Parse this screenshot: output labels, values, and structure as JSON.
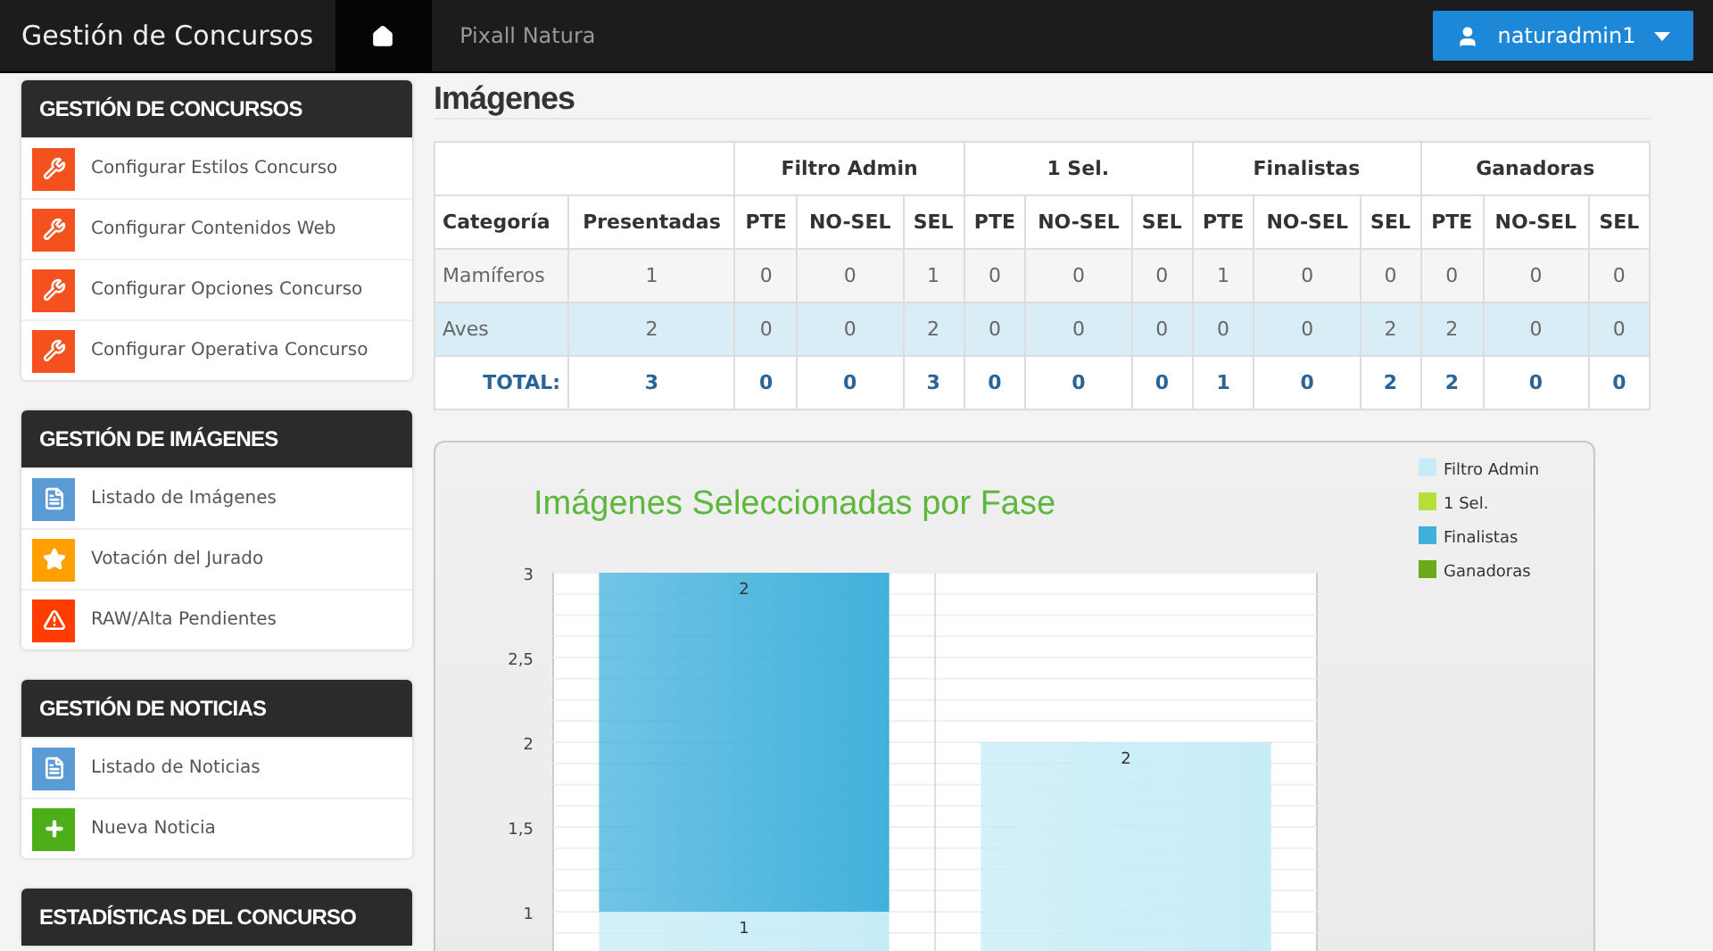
{
  "navbar": {
    "brand": "Gestión de Concursos",
    "tabs": [
      {
        "kind": "home",
        "selected": true
      },
      {
        "kind": "text",
        "label": "Pixall Natura",
        "selected": false
      }
    ],
    "user_button": {
      "label": "naturadmin1"
    }
  },
  "sidebar": {
    "sections": [
      {
        "title": "GESTIÓN DE CONCURSOS",
        "items": [
          {
            "kind": "wrench",
            "color": "#f4511e",
            "label": "Configurar Estilos Concurso"
          },
          {
            "kind": "wrench",
            "color": "#f4511e",
            "label": "Configurar Contenidos Web"
          },
          {
            "kind": "wrench",
            "color": "#f4511e",
            "label": "Configurar Opciones Concurso"
          },
          {
            "kind": "wrench",
            "color": "#f4511e",
            "label": "Configurar Operativa Concurso"
          }
        ]
      },
      {
        "title": "GESTIÓN DE IMÁGENES",
        "items": [
          {
            "kind": "document",
            "color": "#5b9bd5",
            "label": "Listado de Imágenes"
          },
          {
            "kind": "star",
            "color": "#ffa000",
            "label": "Votación del Jurado"
          },
          {
            "kind": "warning",
            "color": "#ff3d00",
            "label": "RAW/Alta Pendientes"
          }
        ]
      },
      {
        "title": "GESTIÓN DE NOTICIAS",
        "items": [
          {
            "kind": "document",
            "color": "#5b9bd5",
            "label": "Listado de Noticias"
          },
          {
            "kind": "plus",
            "color": "#4caf1a",
            "label": "Nueva Noticia"
          }
        ]
      },
      {
        "title": "ESTADÍSTICAS DEL CONCURSO"
      }
    ]
  },
  "main": {
    "title": "Imágenes",
    "table": {
      "group_headers": [
        "Filtro Admin",
        "1 Sel.",
        "Finalistas",
        "Ganadoras"
      ],
      "columns": [
        "Categoría",
        "Presentadas",
        "PTE",
        "NO-SEL",
        "SEL",
        "PTE",
        "NO-SEL",
        "SEL",
        "PTE",
        "NO-SEL",
        "SEL",
        "PTE",
        "NO-SEL",
        "SEL"
      ],
      "rows": [
        {
          "kind": "data",
          "highlighted": false,
          "cells": [
            "Mamíferos",
            "1",
            "0",
            "0",
            "1",
            "0",
            "0",
            "0",
            "1",
            "0",
            "0",
            "0",
            "0",
            "0"
          ]
        },
        {
          "kind": "data",
          "highlighted": true,
          "cells": [
            "Aves",
            "2",
            "0",
            "0",
            "2",
            "0",
            "0",
            "0",
            "0",
            "0",
            "2",
            "2",
            "0",
            "0"
          ]
        },
        {
          "kind": "total",
          "highlighted": false,
          "cells": [
            "TOTAL:",
            "3",
            "0",
            "0",
            "3",
            "0",
            "0",
            "0",
            "1",
            "0",
            "2",
            "2",
            "0",
            "0"
          ]
        }
      ]
    },
    "chart": {
      "chart_data": {
        "type": "bar",
        "stacked": true,
        "title": "Imágenes Seleccionadas por Fase",
        "data_labels": true,
        "grid": true,
        "legend": true,
        "ylim": [
          0,
          3
        ],
        "value_labels": [
          [
            "1",
            "2"
          ],
          [
            null,
            null
          ],
          [
            "2",
            null
          ],
          [
            null,
            null
          ]
        ],
        "yticks": [
          1,
          {
            "value": 1.5,
            "label": "1,5"
          },
          2,
          {
            "value": 2.5,
            "label": "2,5"
          },
          3
        ],
        "series": [
          {
            "name": "Filtro Admin",
            "color": "#c6ecf8",
            "values": [
              1,
              2
            ]
          },
          {
            "name": "1 Sel.",
            "color": "#b5e03a",
            "values": [
              0,
              0
            ]
          },
          {
            "name": "Finalistas",
            "color": "#41b1dc",
            "values": [
              2,
              0
            ]
          },
          {
            "name": "Ganadoras",
            "color": "#6aaa1a",
            "values": [
              0,
              0
            ]
          }
        ]
      }
    }
  }
}
